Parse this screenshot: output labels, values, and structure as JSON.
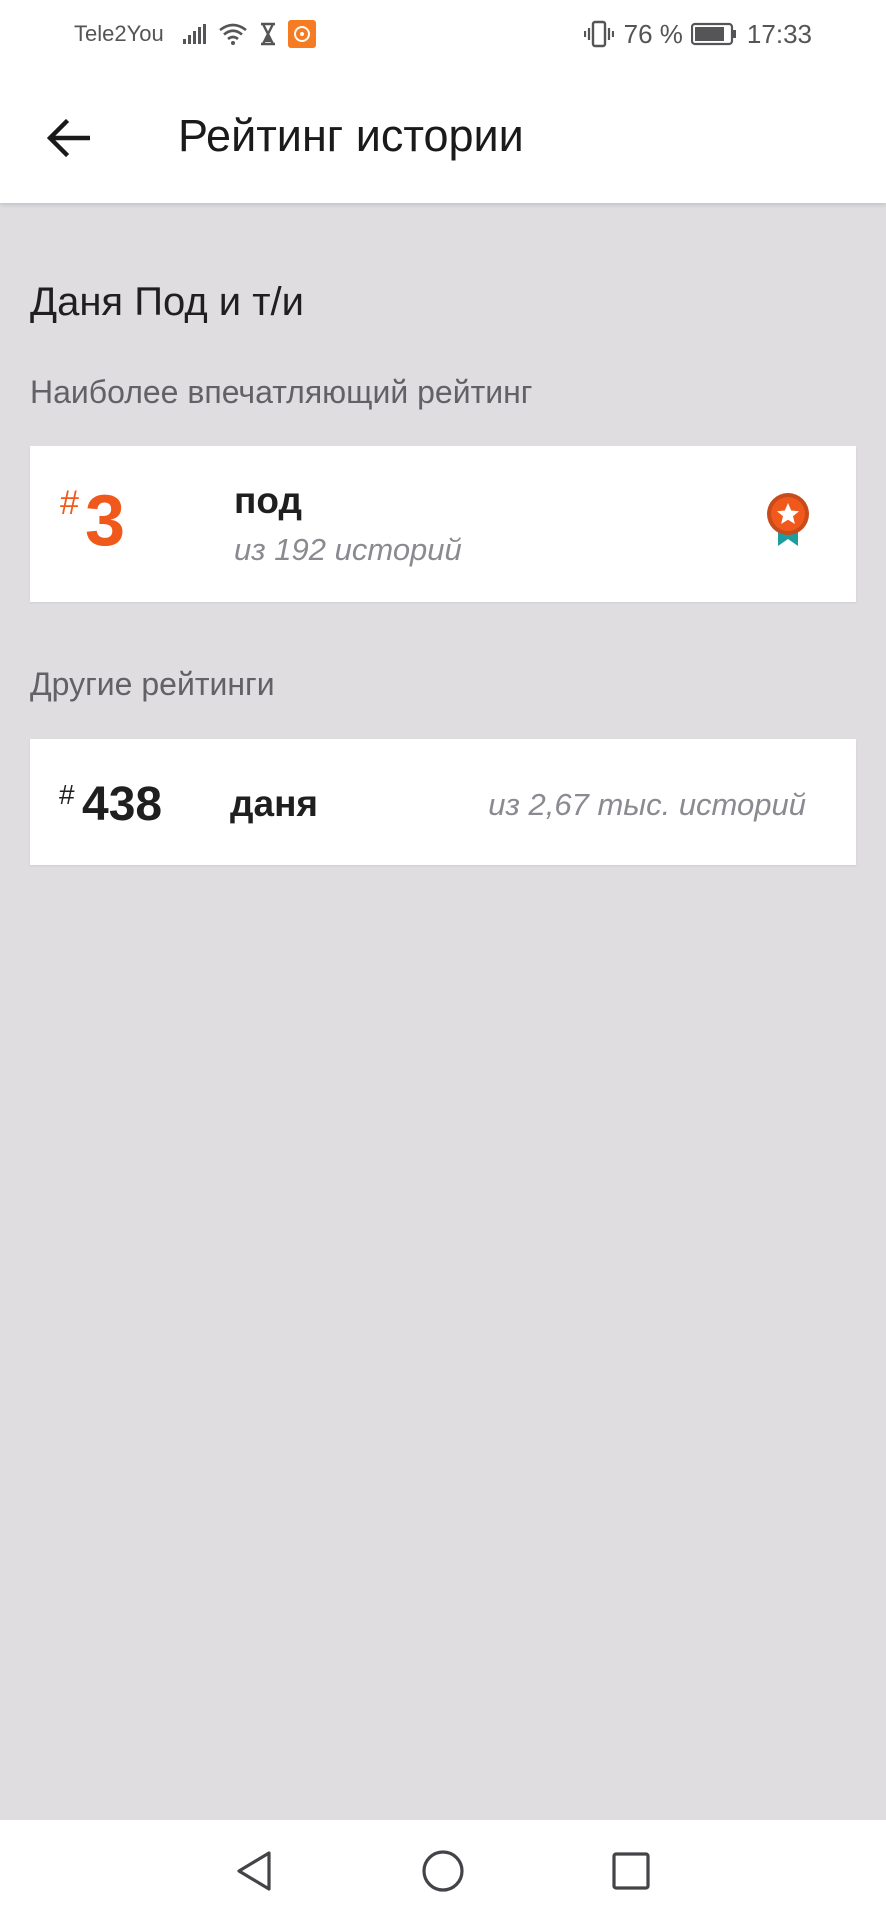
{
  "status_bar": {
    "carrier": "Tele2You",
    "battery": "76 %",
    "time": "17:33"
  },
  "appbar": {
    "title": "Рейтинг истории"
  },
  "story": {
    "title": "Даня Под и т/и"
  },
  "top_ranking": {
    "section_label": "Наиболее впечатляющий рейтинг",
    "hash": "#",
    "rank": "3",
    "tag": "под",
    "subtitle": "из 192 историй",
    "icon": "award-ribbon-icon",
    "accent_color": "#f0591b"
  },
  "other_rankings": {
    "section_label": "Другие рейтинги",
    "items": [
      {
        "hash": "#",
        "rank": "438",
        "tag": "даня",
        "subtitle": "из 2,67 тыс. историй"
      }
    ]
  },
  "colors": {
    "background": "#dfdde0",
    "card": "#ffffff",
    "award_teal": "#1c9e9e"
  }
}
